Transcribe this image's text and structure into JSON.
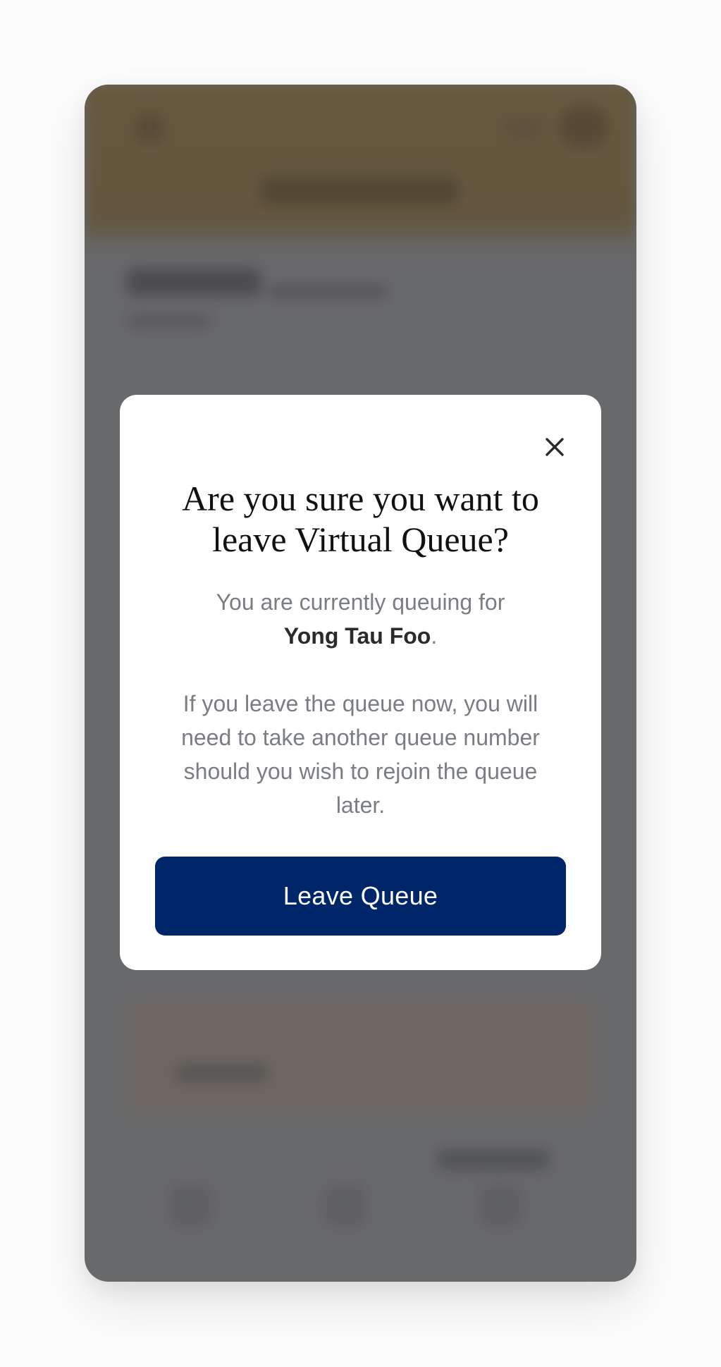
{
  "modal": {
    "title": "Are you sure you want to leave Virtual Queue?",
    "body_prefix": "You are currently queuing for ",
    "stall_name": "Yong Tau Foo",
    "body_suffix": ".",
    "warning": "If you leave the queue now, you will need to take another queue number should you wish to rejoin the queue later.",
    "leave_label": "Leave Queue",
    "close_icon": "close-icon"
  },
  "colors": {
    "primary_button": "#00266a",
    "header_background": "#715d36",
    "overlay": "#727374"
  }
}
